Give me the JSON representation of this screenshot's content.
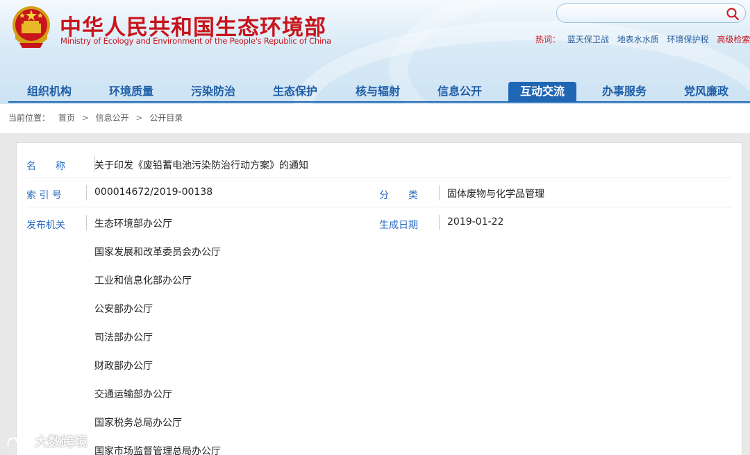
{
  "header": {
    "title_cn": "中华人民共和国生态环境部",
    "title_en": "Ministry of Ecology and Environment of the People's Republic of China",
    "emblem_icon": "national-emblem-icon",
    "search": {
      "value": "",
      "placeholder": ""
    },
    "hot": {
      "label": "热词：",
      "keywords": [
        "蓝天保卫战",
        "地表水水质",
        "环境保护税"
      ],
      "advanced": "高级检索"
    }
  },
  "nav": {
    "items": [
      "组织机构",
      "环境质量",
      "污染防治",
      "生态保护",
      "核与辐射",
      "信息公开",
      "互动交流",
      "办事服务",
      "党风廉政"
    ],
    "active_index": 6,
    "accent": "#1f66b4"
  },
  "breadcrumb": {
    "prefix": "当前位置：",
    "items": [
      "首页",
      "信息公开",
      "公开目录"
    ],
    "separator": ">"
  },
  "doc": {
    "name_label": "名　　称",
    "name_value": "关于印发《废铅蓄电池污染防治行动方案》的通知",
    "index_label": "索 引 号",
    "index_value": "000014672/2019-00138",
    "category_label": "分　　类",
    "category_value": "固体废物与化学品管理",
    "issuer_label": "发布机关",
    "date_label": "生成日期",
    "date_value": "2019-01-22",
    "issuers": [
      "生态环境部办公厅",
      "国家发展和改革委员会办公厅",
      "工业和信息化部办公厅",
      "公安部办公厅",
      "司法部办公厅",
      "财政部办公厅",
      "交通运输部办公厅",
      "国家税务总局办公厅",
      "国家市场监督管理总局办公厅"
    ]
  },
  "watermark": {
    "text": "大数跨境"
  },
  "colors": {
    "brand_red": "#c8141b",
    "link_blue": "#2a6bbf"
  }
}
